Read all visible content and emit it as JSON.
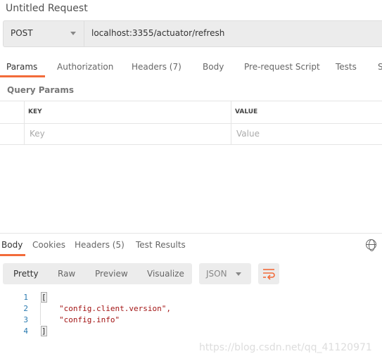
{
  "title": "Untitled Request",
  "request": {
    "method": "POST",
    "url": "localhost:3355/actuator/refresh"
  },
  "tabs": {
    "params": "Params",
    "authorization": "Authorization",
    "headers": "Headers",
    "headers_count": "(7)",
    "body": "Body",
    "prerequest": "Pre-request Script",
    "tests": "Tests",
    "settings": "S"
  },
  "query_params": {
    "label": "Query Params",
    "key_header": "KEY",
    "value_header": "VALUE",
    "key_placeholder": "Key",
    "value_placeholder": "Value"
  },
  "response": {
    "tabs": {
      "body": "Body",
      "cookies": "Cookies",
      "headers": "Headers",
      "headers_count": "(5)",
      "test_results": "Test Results"
    },
    "formats": [
      "Pretty",
      "Raw",
      "Preview",
      "Visualize"
    ],
    "language": "JSON",
    "lines": [
      {
        "n": "1",
        "t": "["
      },
      {
        "n": "2",
        "t": "\"config.client.version\","
      },
      {
        "n": "3",
        "t": "\"config.info\""
      },
      {
        "n": "4",
        "t": "]"
      }
    ]
  },
  "accent": "#f26b3a",
  "watermark": "https://blog.csdn.net/qq_41120971"
}
